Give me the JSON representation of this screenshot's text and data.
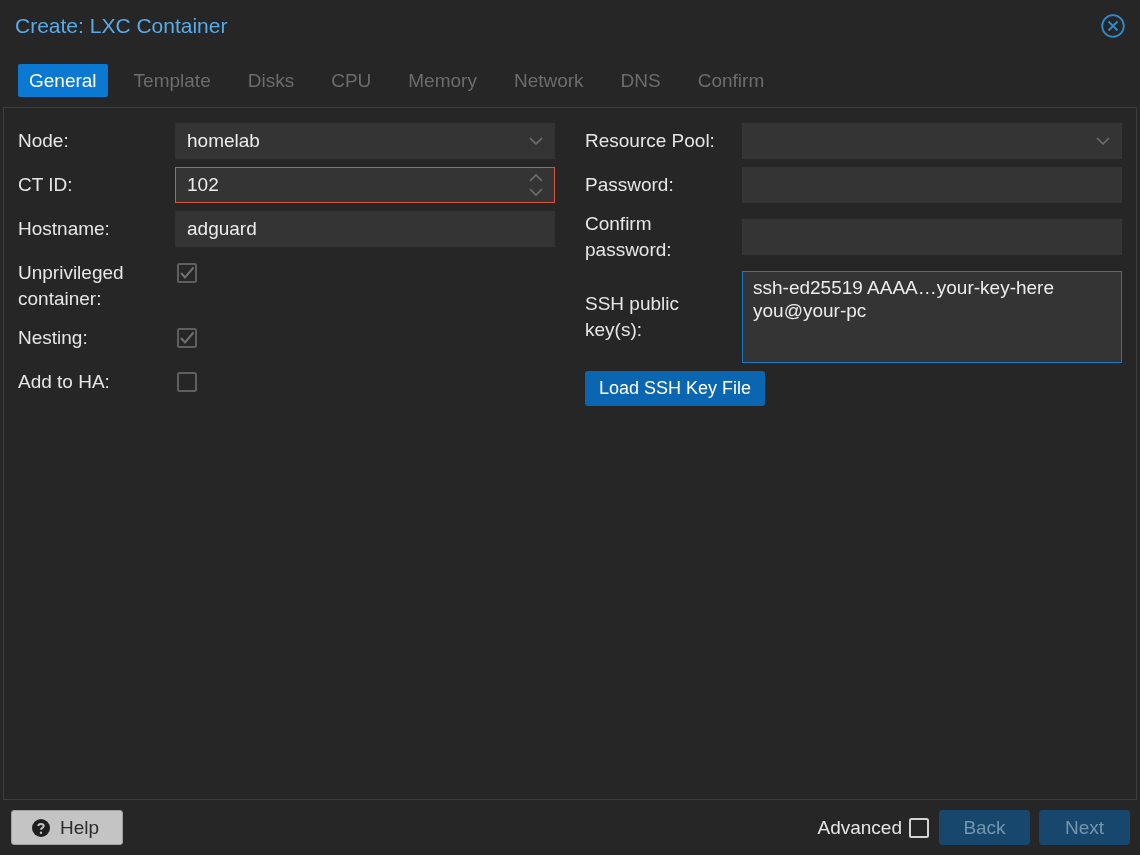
{
  "window": {
    "title": "Create: LXC Container"
  },
  "tabs": [
    {
      "label": "General",
      "selected": true,
      "disabled": false
    },
    {
      "label": "Template",
      "selected": false,
      "disabled": true
    },
    {
      "label": "Disks",
      "selected": false,
      "disabled": true
    },
    {
      "label": "CPU",
      "selected": false,
      "disabled": true
    },
    {
      "label": "Memory",
      "selected": false,
      "disabled": true
    },
    {
      "label": "Network",
      "selected": false,
      "disabled": true
    },
    {
      "label": "DNS",
      "selected": false,
      "disabled": true
    },
    {
      "label": "Confirm",
      "selected": false,
      "disabled": true
    }
  ],
  "general": {
    "left_fields": [
      {
        "kind": "combo",
        "label": "Node:",
        "value": "homelab"
      },
      {
        "kind": "number",
        "label": "CT ID:",
        "value": "102",
        "invalid": true
      },
      {
        "kind": "text",
        "label": "Hostname:",
        "value": "adguard"
      },
      {
        "kind": "checkbox",
        "label": "Unprivileged container:",
        "checked": true
      },
      {
        "kind": "checkbox",
        "label": "Nesting:",
        "checked": true
      },
      {
        "kind": "checkbox",
        "label": "Add to HA:",
        "checked": false
      }
    ],
    "right_fields": [
      {
        "kind": "combo",
        "label": "Resource Pool:"
      },
      {
        "kind": "password",
        "label": "Password:"
      },
      {
        "kind": "password",
        "label": "Confirm password:"
      },
      {
        "kind": "textarea",
        "label": "SSH public key(s):",
        "value": "ssh-ed25519 AAAA…your-key-here you@your-pc",
        "focused": true
      }
    ],
    "load_button": "Load SSH Key File"
  },
  "footer": {
    "help_button": "Help",
    "advanced": {
      "label": "Advanced",
      "checked": false
    },
    "back_button": {
      "label": "Back",
      "disabled": true
    },
    "next_button": {
      "label": "Next",
      "disabled": true
    }
  }
}
